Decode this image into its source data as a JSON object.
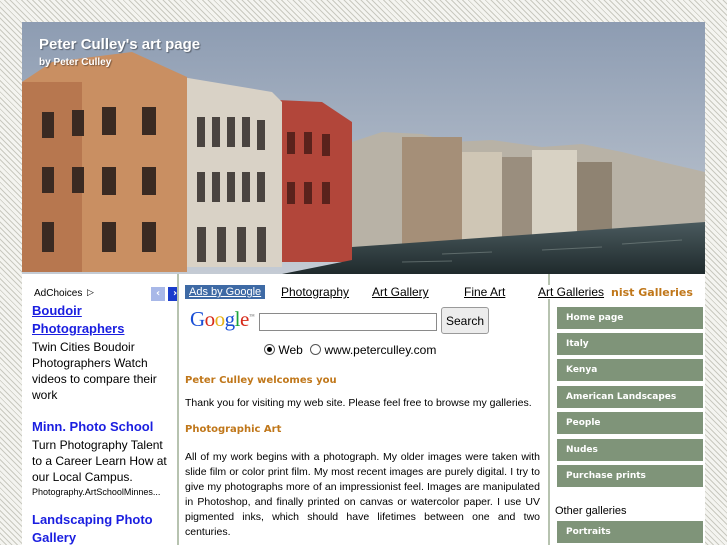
{
  "header": {
    "title": "Peter Culley's art page",
    "byline": "by Peter Culley"
  },
  "ads": {
    "adchoices_label": "AdChoices",
    "items": [
      {
        "title_line1": "Boudoir",
        "title_line2": "Photographers",
        "body": "Twin Cities Boudoir Photographers Watch videos to compare their work"
      },
      {
        "title": "Minn. Photo School",
        "body": "Turn Photography Talent to a Career Learn How at our Local Campus.",
        "url": "Photography.ArtSchoolMinnes..."
      },
      {
        "title_line1": "Landscaping Photo",
        "title_line2": "Gallery"
      }
    ]
  },
  "linkbar": {
    "ads_by_google": "Ads by Google",
    "links": [
      "Photography",
      "Art Gallery",
      "Fine Art",
      "Art Galleries"
    ]
  },
  "search": {
    "logo_letters": [
      {
        "ch": "G",
        "color": "#1a4fd6"
      },
      {
        "ch": "o",
        "color": "#d62a1a"
      },
      {
        "ch": "o",
        "color": "#e8b21a"
      },
      {
        "ch": "g",
        "color": "#1a4fd6"
      },
      {
        "ch": "l",
        "color": "#1aa33a"
      },
      {
        "ch": "e",
        "color": "#d62a1a"
      }
    ],
    "logo_tm": "™",
    "button_label": "Search",
    "input_value": "",
    "option_web": "Web",
    "option_site": "www.peterculley.com"
  },
  "main": {
    "welcome_heading": "Peter Culley welcomes you",
    "welcome_text": "Thank you for visiting my web site. Please feel free to browse my galleries.",
    "art_heading": "Photographic Art",
    "art_text": "All of my work begins with a photograph. My older images were taken with slide film or color print film. My most recent images are purely digital. I try to give my photographs more of an impressionist feel. Images are manipulated in Photoshop, and finally printed on canvas or watercolor paper. I use UV pigmented inks, which should have lifetimes between one and two centuries."
  },
  "sidebar": {
    "heading_fragment": "nist Galleries",
    "nav_items": [
      "Home page",
      "Italy",
      "Kenya",
      "American Landscapes",
      "People",
      "Nudes",
      "Purchase prints"
    ],
    "other_label": "Other galleries",
    "other_items": [
      "Portraits"
    ]
  },
  "colors": {
    "accent_orange": "#c0771a",
    "nav_green": "#7f9479",
    "ad_link_blue": "#1a1ee0",
    "ads_by_google_bg": "#3e6aa5"
  }
}
